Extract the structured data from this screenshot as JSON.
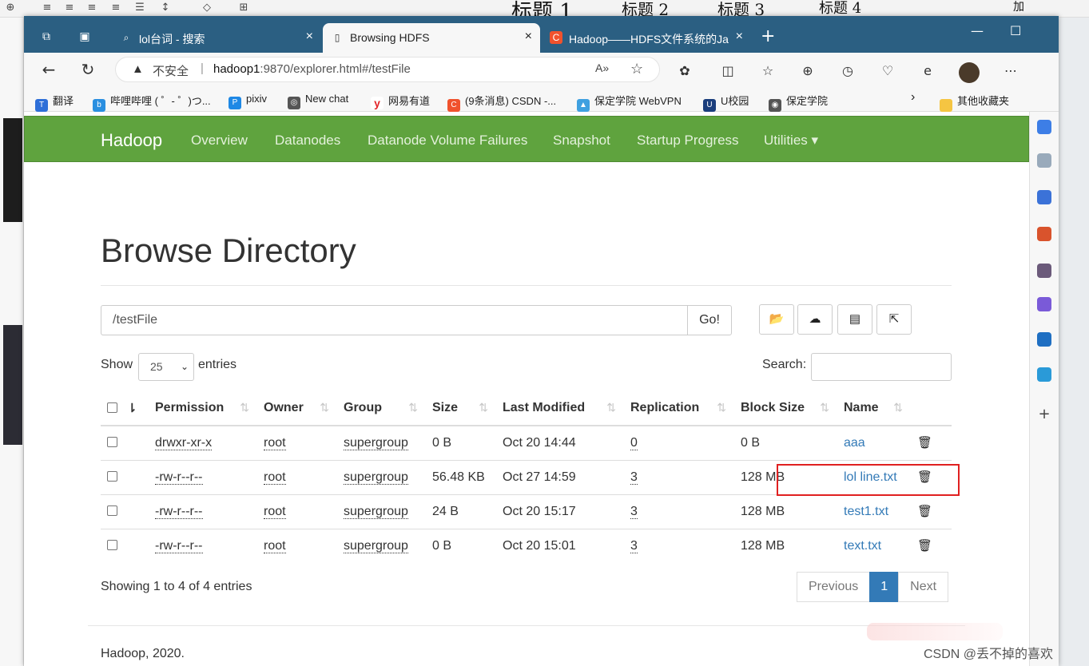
{
  "background_doc": {
    "headings": [
      "标题 1",
      "标题 2",
      "标题 3",
      "标题 4"
    ],
    "right_label": "加"
  },
  "browser": {
    "tabs": [
      {
        "title": "lol台词 - 搜索",
        "icon": "search-icon",
        "active": false
      },
      {
        "title": "Browsing HDFS",
        "icon": "page-icon",
        "active": true
      },
      {
        "title": "Hadoop——HDFS文件系统的Jav",
        "icon": "csdn-icon",
        "active": false
      }
    ],
    "address": {
      "insecure_label": "不安全",
      "separator": "|",
      "host": "hadoop1",
      "path": ":9870/explorer.html#/testFile"
    },
    "bookmarks": [
      {
        "label": "翻译",
        "icon": "translate-icon",
        "color": "#2e6fd8"
      },
      {
        "label": "哔哩哔哩 ( ゜- ゜)つ...",
        "icon": "bilibili-icon",
        "color": "#2a8fe0"
      },
      {
        "label": "pixiv",
        "icon": "pixiv-icon",
        "color": "#1e88e5"
      },
      {
        "label": "New chat",
        "icon": "chat-icon",
        "color": "#555555"
      },
      {
        "label": "网易有道",
        "icon": "youdao-icon",
        "color": "#e3262a"
      },
      {
        "label": "(9条消息) CSDN -...",
        "icon": "csdn-icon",
        "color": "#f0522d"
      },
      {
        "label": "保定学院 WebVPN",
        "icon": "vpn-icon",
        "color": "#3fa0e0"
      },
      {
        "label": "U校园",
        "icon": "u-icon",
        "color": "#1a3d7c"
      },
      {
        "label": "保定学院",
        "icon": "globe-icon",
        "color": "#555555"
      }
    ],
    "other_bookmarks": "其他收藏夹"
  },
  "hadoop": {
    "brand": "Hadoop",
    "nav": [
      "Overview",
      "Datanodes",
      "Datanode Volume Failures",
      "Snapshot",
      "Startup Progress",
      "Utilities ▾"
    ],
    "title": "Browse Directory",
    "path": "/testFile",
    "go_label": "Go!",
    "show_label": "Show",
    "entries_value": "25",
    "entries_label": "entries",
    "search_label": "Search:",
    "columns": [
      "Permission",
      "Owner",
      "Group",
      "Size",
      "Last Modified",
      "Replication",
      "Block Size",
      "Name"
    ],
    "rows": [
      {
        "permission": "drwxr-xr-x",
        "owner": "root",
        "group": "supergroup",
        "size": "0 B",
        "modified": "Oct 20 14:44",
        "replication": "0",
        "block": "0 B",
        "name": "aaa"
      },
      {
        "permission": "-rw-r--r--",
        "owner": "root",
        "group": "supergroup",
        "size": "56.48 KB",
        "modified": "Oct 27 14:59",
        "replication": "3",
        "block": "128 MB",
        "name": "lol line.txt"
      },
      {
        "permission": "-rw-r--r--",
        "owner": "root",
        "group": "supergroup",
        "size": "24 B",
        "modified": "Oct 20 15:17",
        "replication": "3",
        "block": "128 MB",
        "name": "test1.txt"
      },
      {
        "permission": "-rw-r--r--",
        "owner": "root",
        "group": "supergroup",
        "size": "0 B",
        "modified": "Oct 20 15:01",
        "replication": "3",
        "block": "128 MB",
        "name": "text.txt"
      }
    ],
    "showing": "Showing 1 to 4 of 4 entries",
    "pager": {
      "prev": "Previous",
      "current": "1",
      "next": "Next"
    },
    "footer": "Hadoop, 2020."
  },
  "watermark": "CSDN @丢不掉的喜欢",
  "colors": {
    "navbar": "#5fa33e",
    "link": "#337ab7",
    "tabbar": "#2b5f82",
    "highlight_box": "#e02020"
  }
}
